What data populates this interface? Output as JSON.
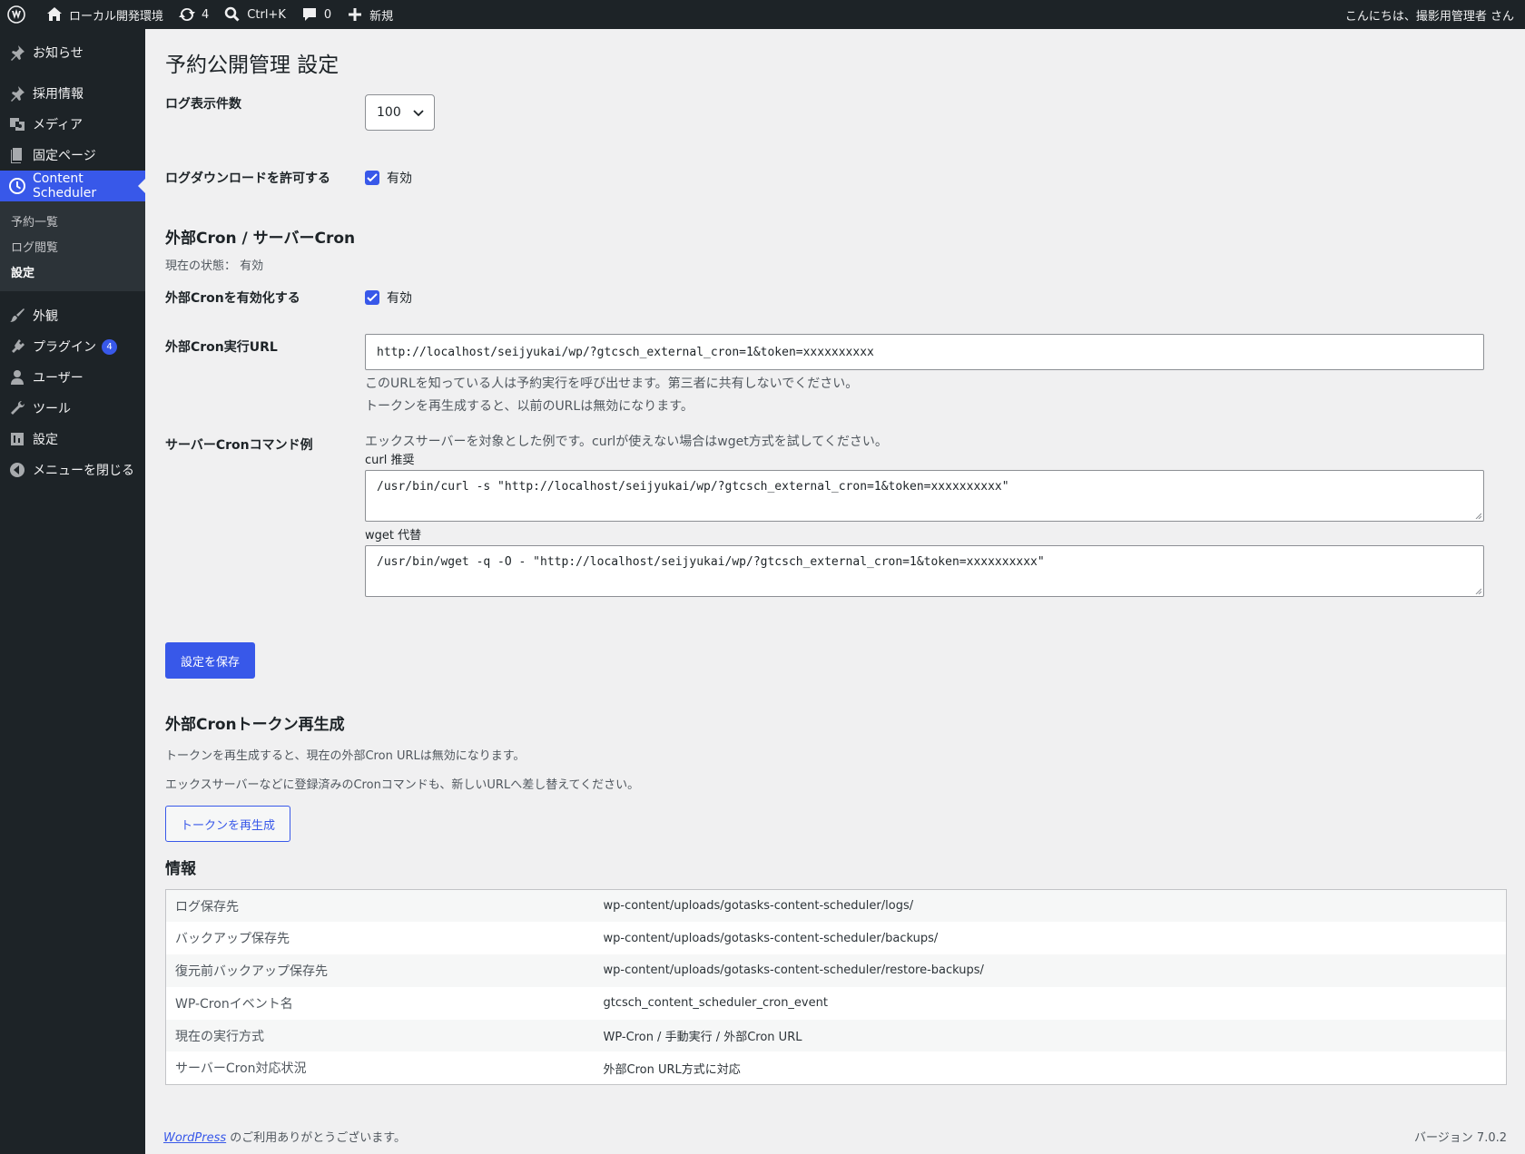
{
  "adminbar": {
    "site_name": "ローカル開発環境",
    "updates_count": "4",
    "search_label": "Ctrl+K",
    "comments_count": "0",
    "new_label": "新規",
    "greeting": "こんにちは、撮影用管理者 さん"
  },
  "sidebar": {
    "items_top": [
      {
        "label": "お知らせ",
        "icon": "pin-icon"
      },
      {
        "label": "採用情報",
        "icon": "pin-icon"
      },
      {
        "label": "メディア",
        "icon": "media-icon"
      },
      {
        "label": "固定ページ",
        "icon": "page-icon"
      }
    ],
    "current": {
      "label": "Content Scheduler",
      "icon": "clock-icon"
    },
    "submenu": [
      "予約一覧",
      "ログ閲覧",
      "設定"
    ],
    "items_bottom": [
      {
        "label": "外観",
        "icon": "brush-icon"
      },
      {
        "label": "プラグイン",
        "icon": "plugin-icon",
        "badge": "4"
      },
      {
        "label": "ユーザー",
        "icon": "user-icon"
      },
      {
        "label": "ツール",
        "icon": "wrench-icon"
      },
      {
        "label": "設定",
        "icon": "settings-icon"
      },
      {
        "label": "メニューを閉じる",
        "icon": "collapse-icon"
      }
    ]
  },
  "page": {
    "title": "予約公開管理 設定",
    "log_count_label": "ログ表示件数",
    "log_count_value": "100",
    "log_download_label": "ログダウンロードを許可する",
    "log_download_cb": "有効",
    "cron_section_title": "外部Cron / サーバーCron",
    "current_status": "現在の状態： 有効",
    "ext_cron_enable_label": "外部Cronを有効化する",
    "ext_cron_enable_cb": "有効",
    "ext_cron_url_label": "外部Cron実行URL",
    "ext_cron_url": "http://localhost/seijyukai/wp/?gtcsch_external_cron=1&token=xxxxxxxxxx",
    "url_desc1": "このURLを知っている人は予約実行を呼び出せます。第三者に共有しないでください。",
    "url_desc2": "トークンを再生成すると、以前のURLは無効になります。",
    "server_cron_label": "サーバーCronコマンド例",
    "server_cron_desc": "エックスサーバーを対象とした例です。curlが使えない場合はwget方式を試してください。",
    "curl_label": "curl 推奨",
    "curl_cmd": "/usr/bin/curl -s \"http://localhost/seijyukai/wp/?gtcsch_external_cron=1&token=xxxxxxxxxx\"",
    "wget_label": "wget 代替",
    "wget_cmd": "/usr/bin/wget -q -O - \"http://localhost/seijyukai/wp/?gtcsch_external_cron=1&token=xxxxxxxxxx\"",
    "save_button": "設定を保存",
    "regen_title": "外部Cronトークン再生成",
    "regen_desc1": "トークンを再生成すると、現在の外部Cron URLは無効になります。",
    "regen_desc2": "エックスサーバーなどに登録済みのCronコマンドも、新しいURLへ差し替えてください。",
    "regen_button": "トークンを再生成",
    "info_title": "情報",
    "info_rows": [
      {
        "k": "ログ保存先",
        "v": "wp-content/uploads/gotasks-content-scheduler/logs/"
      },
      {
        "k": "バックアップ保存先",
        "v": "wp-content/uploads/gotasks-content-scheduler/backups/"
      },
      {
        "k": "復元前バックアップ保存先",
        "v": "wp-content/uploads/gotasks-content-scheduler/restore-backups/"
      },
      {
        "k": "WP-Cronイベント名",
        "v": "gtcsch_content_scheduler_cron_event"
      },
      {
        "k": "現在の実行方式",
        "v": "WP-Cron / 手動実行 / 外部Cron URL"
      },
      {
        "k": "サーバーCron対応状況",
        "v": "外部Cron URL方式に対応"
      }
    ]
  },
  "footer": {
    "wp_link": "WordPress",
    "thanks": " のご利用ありがとうございます。",
    "version": "バージョン 7.0.2"
  },
  "colors": {
    "accent": "#3858e9",
    "adminbar": "#1d2327",
    "background": "#f0f0f1"
  }
}
